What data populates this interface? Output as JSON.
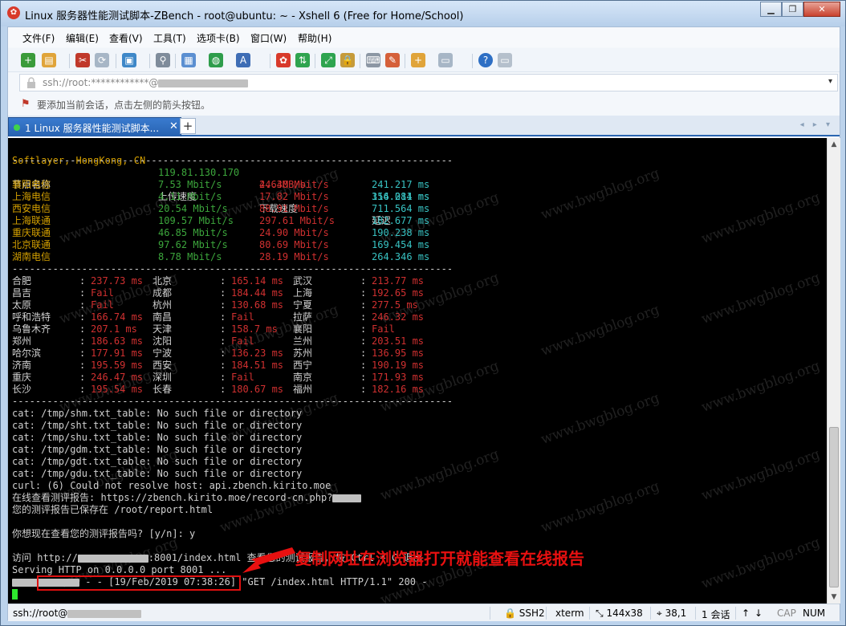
{
  "window": {
    "title": "Linux 服务器性能测试脚本-ZBench - root@ubuntu: ~ - Xshell 6 (Free for Home/School)",
    "min_label": "▁",
    "max_label": "❐",
    "close_label": "✕"
  },
  "menu": {
    "items": [
      "文件(F)",
      "编辑(E)",
      "查看(V)",
      "工具(T)",
      "选项卡(B)",
      "窗口(W)",
      "帮助(H)"
    ]
  },
  "address": {
    "text": "ssh://root:************@",
    "dropdown": "▾"
  },
  "hint": {
    "text": "要添加当前会话，点击左侧的箭头按钮。"
  },
  "tab": {
    "label": "1 Linux 服务器性能测试脚本...",
    "close": "✕",
    "add": "+",
    "nav": "◂ ▸ ▾"
  },
  "terminal": {
    "softlayer": {
      "node": "Softlayer, HongKong, CN",
      "ip": "119.81.130.170",
      "speed": "2.63MB/s",
      "latency": "154.214 ms"
    },
    "divider": "----------------------------------------------------------------------------",
    "headers": {
      "node": "节点名称",
      "upload": "上传速度",
      "download": "下载速度",
      "latency": "延迟"
    },
    "speed_rows": [
      {
        "node": "襄阳电信",
        "up": "7.53 Mbit/s",
        "down": "44.40 Mbit/s",
        "lat": "241.217 ms"
      },
      {
        "node": "上海电信",
        "up": "4.11 Mbit/s",
        "down": "17.82 Mbit/s",
        "lat": "316.081 ms"
      },
      {
        "node": "西安电信",
        "up": "20.54 Mbit/s",
        "down": "88.91 Mbit/s",
        "lat": "711.564 ms"
      },
      {
        "node": "上海联通",
        "up": "109.57 Mbit/s",
        "down": "297.61 Mbit/s",
        "lat": "182.677 ms"
      },
      {
        "node": "重庆联通",
        "up": "46.85 Mbit/s",
        "down": "24.90 Mbit/s",
        "lat": "190.238 ms"
      },
      {
        "node": "北京联通",
        "up": "97.62 Mbit/s",
        "down": "80.69 Mbit/s",
        "lat": "169.454 ms"
      },
      {
        "node": "湖南电信",
        "up": "8.78 Mbit/s",
        "down": "28.19 Mbit/s",
        "lat": "264.346 ms"
      }
    ],
    "ping_rows": [
      [
        {
          "city": "合肥",
          "val": "237.73 ms"
        },
        {
          "city": "北京",
          "val": "165.14 ms"
        },
        {
          "city": "武汉",
          "val": "213.77 ms"
        }
      ],
      [
        {
          "city": "昌吉",
          "val": "Fail"
        },
        {
          "city": "成都",
          "val": "184.44 ms"
        },
        {
          "city": "上海",
          "val": "192.65 ms"
        }
      ],
      [
        {
          "city": "太原",
          "val": "Fail"
        },
        {
          "city": "杭州",
          "val": "130.68 ms"
        },
        {
          "city": "宁夏",
          "val": "277.5 ms"
        }
      ],
      [
        {
          "city": "呼和浩特",
          "val": "166.74 ms"
        },
        {
          "city": "南昌",
          "val": "Fail"
        },
        {
          "city": "拉萨",
          "val": "246.32 ms"
        }
      ],
      [
        {
          "city": "乌鲁木齐",
          "val": "207.1 ms"
        },
        {
          "city": "天津",
          "val": "158.7 ms"
        },
        {
          "city": "襄阳",
          "val": "Fail"
        }
      ],
      [
        {
          "city": "郑州",
          "val": "186.63 ms"
        },
        {
          "city": "沈阳",
          "val": "Fail"
        },
        {
          "city": "兰州",
          "val": "203.51 ms"
        }
      ],
      [
        {
          "city": "哈尔滨",
          "val": "177.91 ms"
        },
        {
          "city": "宁波",
          "val": "136.23 ms"
        },
        {
          "city": "苏州",
          "val": "136.95 ms"
        }
      ],
      [
        {
          "city": "济南",
          "val": "195.59 ms"
        },
        {
          "city": "西安",
          "val": "184.51 ms"
        },
        {
          "city": "西宁",
          "val": "190.19 ms"
        }
      ],
      [
        {
          "city": "重庆",
          "val": "246.47 ms"
        },
        {
          "city": "深圳",
          "val": "Fail"
        },
        {
          "city": "南京",
          "val": "171.93 ms"
        }
      ],
      [
        {
          "city": "长沙",
          "val": "195.54 ms"
        },
        {
          "city": "长春",
          "val": "180.67 ms"
        },
        {
          "city": "福州",
          "val": "182.16 ms"
        }
      ]
    ],
    "cat_lines": [
      "cat: /tmp/shm.txt_table: No such file or directory",
      "cat: /tmp/sht.txt_table: No such file or directory",
      "cat: /tmp/shu.txt_table: No such file or directory",
      "cat: /tmp/gdm.txt_table: No such file or directory",
      "cat: /tmp/gdt.txt_table: No such file or directory",
      "cat: /tmp/gdu.txt_table: No such file or directory"
    ],
    "curl_line": "curl: (6) Could not resolve host: api.zbench.kirito.moe",
    "report_url_line": "在线查看测评报告: https://zbench.kirito.moe/record-cn.php?",
    "saved_line": "您的测评报告已保存在 /root/report.html",
    "prompt_line": "你想现在查看您的测评报告吗? [y/n]: y",
    "visit_prefix": "访问 ",
    "visit_url_a": "http://",
    "visit_url_b": ":8001/index.html",
    "visit_suffix": " 查看您的测试报告, 按 Ctrl + C 退出",
    "serving_line": "Serving HTTP on 0.0.0.0 port 8001 ...",
    "log_line": " - - [19/Feb/2019 07:38:26] \"GET /index.html HTTP/1.1\" 200 -",
    "watermark": "www.bwgblog.org"
  },
  "annotation": {
    "text": "复制网址在浏览器打开就能查看在线报告"
  },
  "status": {
    "conn": "ssh://root@",
    "proto": "SSH2",
    "term": "xterm",
    "size": "144x38",
    "pos": "38,1",
    "sessions": "1 会话",
    "cap": "CAP",
    "num": "NUM"
  },
  "colors": {
    "green": "#2ab02a",
    "yellow": "#d4a000",
    "red": "#d03030",
    "cyan": "#38c3c3",
    "annotation_red": "#e81010"
  }
}
